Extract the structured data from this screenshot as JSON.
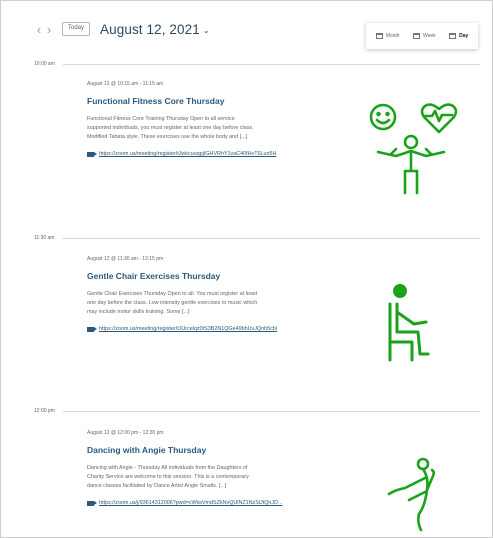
{
  "header": {
    "prev_icon": "chevron-left-icon",
    "next_icon": "chevron-right-icon",
    "today_label": "Today",
    "date_title": "August 12, 2021",
    "date_caret_icon": "chevron-down-icon"
  },
  "views": {
    "items": [
      {
        "label": "Month",
        "icon": "calendar-month-icon",
        "active": false
      },
      {
        "label": "Week",
        "icon": "calendar-week-icon",
        "active": false
      },
      {
        "label": "Day",
        "icon": "calendar-day-icon",
        "active": true
      }
    ]
  },
  "time_slots": [
    {
      "time": "10:00 am"
    },
    {
      "time": "11:30 am"
    },
    {
      "time": "12:00 pm"
    }
  ],
  "events": [
    {
      "meta": "August 12 @ 10:15 am - 11:15 am",
      "title": "Functional Fitness Core Thursday",
      "description": "Functional Fitness Core Training Thursday Open to all service supported individuals, you must register at least one day before class. Modified Tabata style. These exercises use the whole body and [...]",
      "link": "https://zoom.us/meeting/register/tJwkcuuqpjIGHVRhY1vaC40fHxT6Lun5H",
      "icon": "smiley-heart-fitness-icon"
    },
    {
      "meta": "August 12 @ 11:30 am - 12:15 pm",
      "title": "Gentle Chair Exercises Thursday",
      "description": "Gentle Chair Exercises Thursday Open to all. You must register at least one day before the class. Low intensity gentle exercises to music which may include motor skills training. Some [...]",
      "link": "https://zoom.us/meeting/register/tJUrcelqz0tS3B2N1QGe49bhUvJQnh5cbi",
      "icon": "person-chair-icon"
    },
    {
      "meta": "August 12 @ 12:00 pm - 12:30 pm",
      "title": "Dancing with Angie Thursday",
      "description": "Dancing with Angie - Thursday All individuals from the Daughters of Charity Service are welcome to this session. This is a contemporary dance classes facilitated by Dance Artist Angie Smalls. [...]",
      "link": "https://zoom.us/j/93614312006?pwd=cWtwVmdSZkNvQUlNZ1NzSlJtQnJD...",
      "icon": "dancer-icon"
    }
  ],
  "colors": {
    "accent": "#2b5a7e",
    "title": "#2b4a63",
    "illustration": "#1aa31a"
  }
}
